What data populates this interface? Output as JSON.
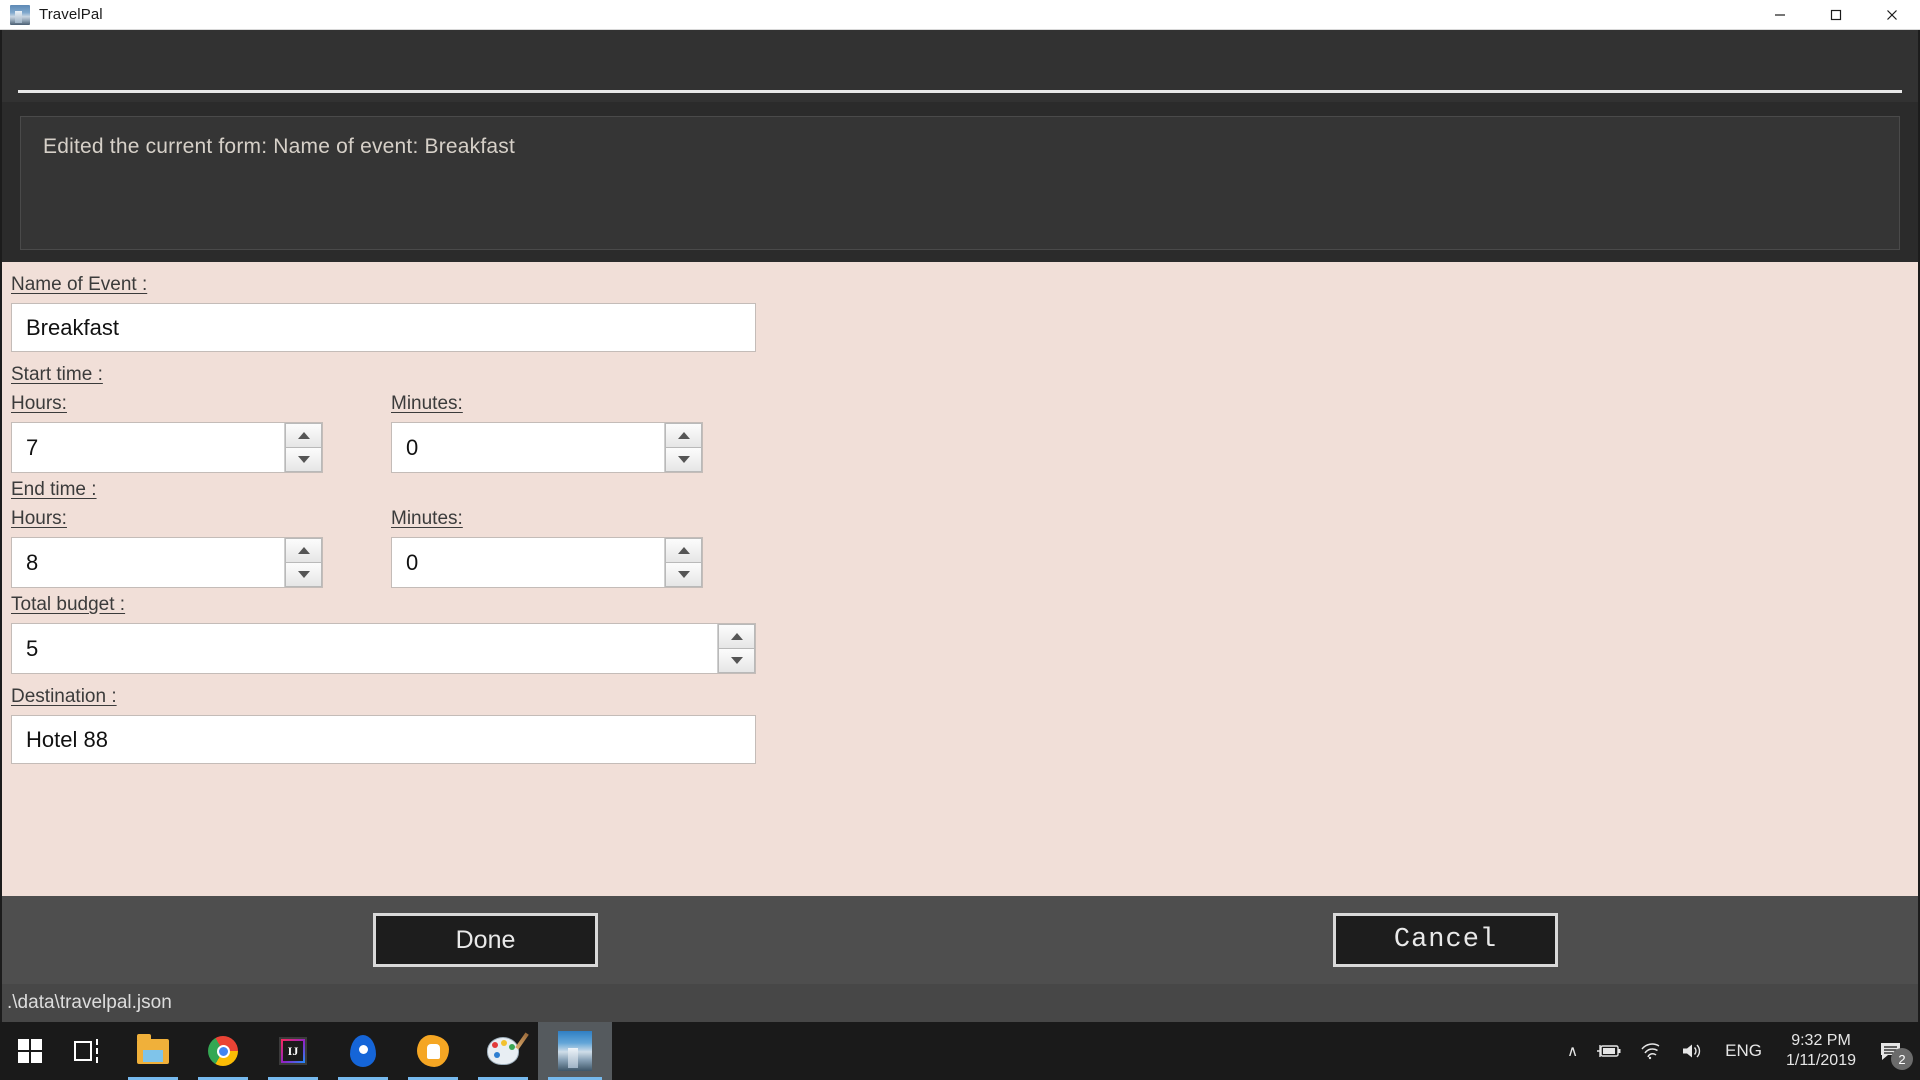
{
  "window": {
    "title": "TravelPal",
    "icon": "travelpal-photo-icon",
    "controls": {
      "minimize": "minimize-icon",
      "maximize": "maximize-icon",
      "close": "close-icon"
    }
  },
  "message": {
    "text": "Edited the current form: Name of event: Breakfast"
  },
  "form": {
    "name_label": "Name of Event : ",
    "name_value": "Breakfast",
    "start_time_label": "Start time : ",
    "start_hours_label": "Hours:",
    "start_hours_value": "7",
    "start_minutes_label": "Minutes:",
    "start_minutes_value": "0",
    "end_time_label": "End time : ",
    "end_hours_label": "Hours:",
    "end_hours_value": "8",
    "end_minutes_label": "Minutes:",
    "end_minutes_value": "0",
    "budget_label": "Total budget : ",
    "budget_value": "5",
    "destination_label": "Destination : ",
    "destination_value": "Hotel 88"
  },
  "buttons": {
    "done": "Done",
    "cancel": "Cancel"
  },
  "statusbar": {
    "path": ".\\data\\travelpal.json"
  },
  "taskbar": {
    "items": [
      {
        "name": "start-button",
        "icon": "windows-logo-icon"
      },
      {
        "name": "task-view-button",
        "icon": "task-view-icon"
      },
      {
        "name": "file-explorer-button",
        "icon": "folder-icon"
      },
      {
        "name": "chrome-button",
        "icon": "chrome-icon"
      },
      {
        "name": "intellij-button",
        "icon": "intellij-idea-icon"
      },
      {
        "name": "location-app-button",
        "icon": "map-pin-icon"
      },
      {
        "name": "orange-app-button",
        "icon": "orange-hand-icon"
      },
      {
        "name": "paint-button",
        "icon": "paint-palette-icon"
      },
      {
        "name": "travelpal-button",
        "icon": "travelpal-photo-icon"
      }
    ],
    "tray": {
      "chevron": "∧",
      "battery": "battery-charging-icon",
      "wifi": "wifi-icon",
      "volume": "volume-icon",
      "language": "ENG",
      "time": "9:32 PM",
      "date": "1/11/2019",
      "notifications": "notification-icon",
      "notification_count": "2"
    }
  },
  "colors": {
    "form_background": "#f1dfd8",
    "panel_dark": "#2b2b2b",
    "header_dark": "#323232",
    "button_bar": "#4e4e4e",
    "status_bar": "#474747",
    "taskbar": "#1a1a1a",
    "accent_underline": "#76b9ed"
  }
}
